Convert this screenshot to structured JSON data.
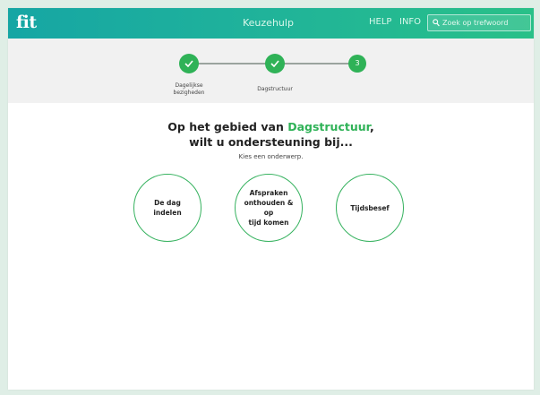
{
  "header": {
    "logo": "fit",
    "title": "Keuzehulp",
    "help": "HELP",
    "info": "INFO",
    "search_placeholder": "Zoek op trefwoord"
  },
  "steps": [
    {
      "label_line1": "Dagelijkse",
      "label_line2": "bezigheden",
      "state": "done",
      "icon": "check-icon"
    },
    {
      "label_line1": "Dagstructuur",
      "label_line2": "",
      "state": "done",
      "icon": "check-icon"
    },
    {
      "label_line1": "",
      "label_line2": "",
      "state": "current",
      "number": "3"
    }
  ],
  "main": {
    "heading_prefix": "Op het gebied van ",
    "heading_accent": "Dagstructuur",
    "heading_suffix": ",",
    "heading_line2": "wilt u ondersteuning bij...",
    "subtitle": "Kies een onderwerp.",
    "topics": [
      {
        "line1": "De dag indelen",
        "line2": "",
        "line3": ""
      },
      {
        "line1": "Afspraken",
        "line2": "onthouden & op",
        "line3": "tijd komen"
      },
      {
        "line1": "Tijdsbesef",
        "line2": "",
        "line3": ""
      }
    ]
  },
  "colors": {
    "accent": "#2fb257",
    "header_gradient_start": "#16a6a4",
    "header_gradient_end": "#29c088"
  }
}
